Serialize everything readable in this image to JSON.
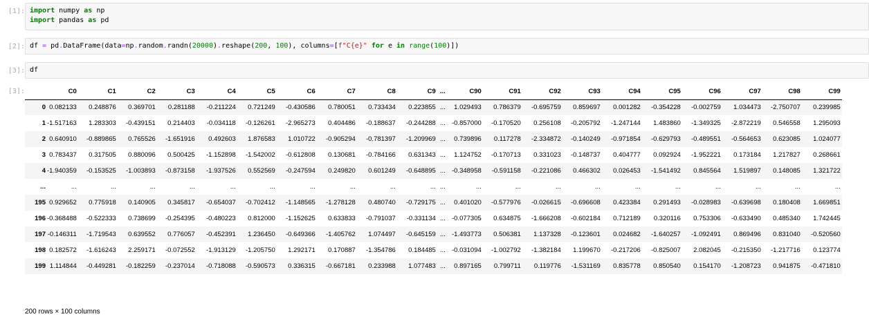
{
  "cells": [
    {
      "prompt": "[1]:",
      "lines": [
        "import numpy as np",
        "import pandas as pd"
      ]
    },
    {
      "prompt": "[2]:",
      "lines": [
        "df = pd.DataFrame(data=np.random.randn(20000).reshape(200, 100), columns=[f\"C{e}\" for e in range(100)])"
      ]
    },
    {
      "prompt": "[3]:",
      "lines": [
        "df"
      ]
    }
  ],
  "output": {
    "prompt": "[3]:",
    "columns": [
      "C0",
      "C1",
      "C2",
      "C3",
      "C4",
      "C5",
      "C6",
      "C7",
      "C8",
      "C9",
      "...",
      "C90",
      "C91",
      "C92",
      "C93",
      "C94",
      "C95",
      "C96",
      "C97",
      "C98",
      "C99"
    ],
    "rows": [
      {
        "index": "0",
        "values": [
          "0.082133",
          "0.248876",
          "0.369701",
          "0.281188",
          "-0.211224",
          "0.721249",
          "-0.430586",
          "0.780051",
          "0.733434",
          "0.223855",
          "...",
          "1.029493",
          "0.786379",
          "-0.695759",
          "0.859697",
          "0.001282",
          "-0.354228",
          "-0.002759",
          "1.034473",
          "-2.750707",
          "0.239985"
        ]
      },
      {
        "index": "1",
        "values": [
          "-1.517163",
          "1.283303",
          "-0.439151",
          "0.214403",
          "-0.034118",
          "-0.126261",
          "-2.965273",
          "0.404486",
          "-0.188637",
          "-0.244288",
          "...",
          "-0.857000",
          "-0.170520",
          "0.256108",
          "-0.205792",
          "-1.247144",
          "1.483860",
          "-1.349325",
          "-2.872219",
          "0.546558",
          "1.295093"
        ]
      },
      {
        "index": "2",
        "values": [
          "0.640910",
          "-0.889865",
          "0.765526",
          "-1.651916",
          "0.492603",
          "1.876583",
          "1.010722",
          "-0.905294",
          "-0.781397",
          "-1.209969",
          "...",
          "0.739896",
          "0.117278",
          "-2.334872",
          "-0.140249",
          "-0.971854",
          "-0.629793",
          "-0.489551",
          "-0.564653",
          "0.623085",
          "1.024077"
        ]
      },
      {
        "index": "3",
        "values": [
          "0.783437",
          "0.317505",
          "0.880096",
          "0.500425",
          "-1.152898",
          "-1.542002",
          "-0.612808",
          "0.130681",
          "-0.784166",
          "0.631343",
          "...",
          "1.124752",
          "-0.170713",
          "0.331023",
          "-0.148737",
          "0.404777",
          "0.092924",
          "-1.952221",
          "0.173184",
          "1.217827",
          "0.268661"
        ]
      },
      {
        "index": "4",
        "values": [
          "-1.940359",
          "-0.153525",
          "-1.003893",
          "-0.873158",
          "-1.937526",
          "0.552569",
          "-0.247594",
          "0.249820",
          "0.601249",
          "-0.648895",
          "...",
          "-0.348958",
          "-0.591158",
          "-0.221086",
          "0.466302",
          "0.026453",
          "-1.541492",
          "0.845564",
          "1.519897",
          "0.148085",
          "1.321722"
        ]
      },
      {
        "index": "...",
        "values": [
          "...",
          "...",
          "...",
          "...",
          "...",
          "...",
          "...",
          "...",
          "...",
          "...",
          "...",
          "...",
          "...",
          "...",
          "...",
          "...",
          "...",
          "...",
          "...",
          "...",
          "..."
        ]
      },
      {
        "index": "195",
        "values": [
          "0.929652",
          "0.775918",
          "0.140905",
          "0.345817",
          "-0.654037",
          "-0.702412",
          "-1.148565",
          "-1.278128",
          "0.480740",
          "-0.729175",
          "...",
          "0.401020",
          "-0.577976",
          "-0.026615",
          "-0.696608",
          "0.423384",
          "0.291493",
          "-0.028983",
          "-0.639698",
          "0.180408",
          "1.669851"
        ]
      },
      {
        "index": "196",
        "values": [
          "-0.368488",
          "-0.522333",
          "0.738699",
          "-0.254395",
          "-0.480223",
          "0.812000",
          "-1.152625",
          "0.633833",
          "-0.791037",
          "-0.331134",
          "...",
          "-0.077305",
          "0.634875",
          "-1.666208",
          "-0.602184",
          "0.712189",
          "0.320116",
          "0.753306",
          "-0.633490",
          "0.485340",
          "1.742445"
        ]
      },
      {
        "index": "197",
        "values": [
          "-0.146311",
          "-1.719543",
          "0.639552",
          "0.776057",
          "-0.452391",
          "1.236450",
          "-0.649366",
          "-1.405762",
          "1.074497",
          "-0.645159",
          "...",
          "-1.493773",
          "0.506381",
          "1.137328",
          "-0.123601",
          "0.024682",
          "-1.640257",
          "-1.092491",
          "0.869496",
          "0.831040",
          "-0.520560"
        ]
      },
      {
        "index": "198",
        "values": [
          "0.182572",
          "-1.616243",
          "2.259171",
          "-0.072552",
          "-1.913129",
          "-1.205750",
          "1.292171",
          "0.170887",
          "-1.354786",
          "0.184485",
          "...",
          "-0.031094",
          "-1.002792",
          "-1.382184",
          "1.199670",
          "-0.217206",
          "-0.825007",
          "2.082045",
          "-0.215350",
          "-1.217716",
          "0.123774"
        ]
      },
      {
        "index": "199",
        "values": [
          "1.114844",
          "-0.449281",
          "-0.182259",
          "-0.237014",
          "-0.718088",
          "-0.590573",
          "0.336315",
          "-0.667181",
          "0.233988",
          "1.077483",
          "...",
          "0.897165",
          "0.799711",
          "0.119776",
          "-1.531169",
          "0.835778",
          "0.850540",
          "0.154170",
          "-1.208723",
          "0.941875",
          "-0.471810"
        ]
      }
    ],
    "footer": "200 rows × 100 columns"
  }
}
